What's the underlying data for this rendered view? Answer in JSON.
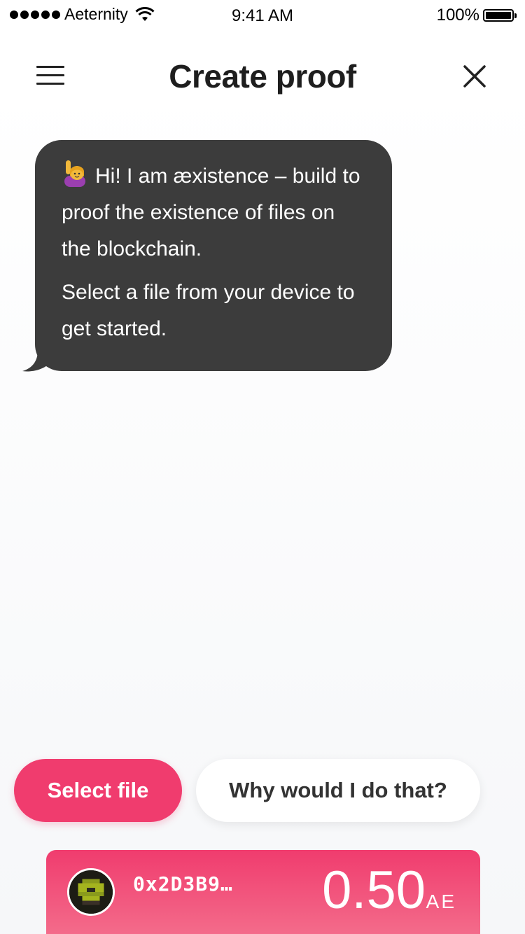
{
  "status_bar": {
    "carrier": "Aeternity",
    "time": "9:41 AM",
    "battery": "100%"
  },
  "header": {
    "title": "Create proof",
    "menu_icon": "hamburger-menu-icon",
    "close_icon": "close-icon"
  },
  "chat": {
    "paragraph1": "Hi! I am æxistence – build to proof the existence of files on the blockchain.",
    "paragraph2": "Select a file from your device to get started."
  },
  "actions": {
    "select_file": "Select file",
    "why": "Why would I do that?"
  },
  "account": {
    "address": "0x2D3B9…",
    "balance": "0.50",
    "currency": "AE"
  },
  "colors": {
    "accent": "#f03c6e",
    "bubble": "#3c3c3c"
  }
}
